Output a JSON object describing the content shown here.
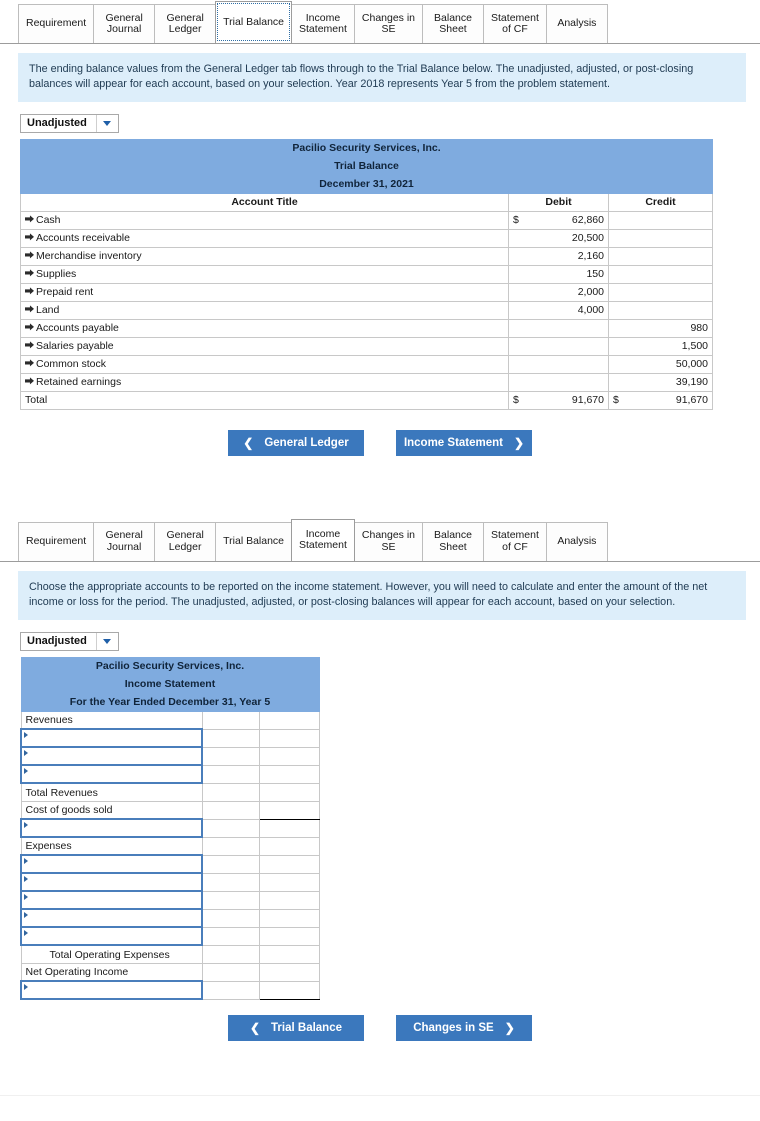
{
  "theme": {
    "accent_blue": "#3b78bd",
    "header_blue": "#7fabdf",
    "info_blue": "#ddeefa"
  },
  "panel1": {
    "tabs": [
      {
        "label": "Requirement",
        "active": false
      },
      {
        "label": "General\nJournal",
        "active": false
      },
      {
        "label": "General\nLedger",
        "active": false
      },
      {
        "label": "Trial Balance",
        "active": true
      },
      {
        "label": "Income\nStatement",
        "active": false
      },
      {
        "label": "Changes in\nSE",
        "active": false
      },
      {
        "label": "Balance\nSheet",
        "active": false
      },
      {
        "label": "Statement\nof CF",
        "active": false
      },
      {
        "label": "Analysis",
        "active": false
      }
    ],
    "instructions": "The ending balance values from the General Ledger tab flows through to the Trial Balance below. The unadjusted, adjusted, or post-closing balances will appear for each account, based on your selection. Year 2018 represents Year 5 from the problem statement.",
    "dropdown_value": "Unadjusted",
    "title_lines": [
      "Pacilio Security Services, Inc.",
      "Trial Balance",
      "December 31, 2021"
    ],
    "columns": [
      "Account Title",
      "Debit",
      "Credit"
    ],
    "rows": [
      {
        "account": "Cash",
        "debit": "62,860",
        "credit": "",
        "dollar_debit": true
      },
      {
        "account": "Accounts receivable",
        "debit": "20,500",
        "credit": ""
      },
      {
        "account": "Merchandise inventory",
        "debit": "2,160",
        "credit": ""
      },
      {
        "account": "Supplies",
        "debit": "150",
        "credit": ""
      },
      {
        "account": "Prepaid rent",
        "debit": "2,000",
        "credit": ""
      },
      {
        "account": "Land",
        "debit": "4,000",
        "credit": ""
      },
      {
        "account": "Accounts payable",
        "debit": "",
        "credit": "980"
      },
      {
        "account": "Salaries payable",
        "debit": "",
        "credit": "1,500"
      },
      {
        "account": "Common stock",
        "debit": "",
        "credit": "50,000"
      },
      {
        "account": "Retained earnings",
        "debit": "",
        "credit": "39,190"
      }
    ],
    "total": {
      "label": "Total",
      "debit": "91,670",
      "credit": "91,670"
    },
    "prev_button": "General Ledger",
    "next_button": "Income Statement"
  },
  "panel2": {
    "tabs": [
      {
        "label": "Requirement",
        "active": false
      },
      {
        "label": "General\nJournal",
        "active": false
      },
      {
        "label": "General\nLedger",
        "active": false
      },
      {
        "label": "Trial Balance",
        "active": false
      },
      {
        "label": "Income\nStatement",
        "active": true
      },
      {
        "label": "Changes in\nSE",
        "active": false
      },
      {
        "label": "Balance\nSheet",
        "active": false
      },
      {
        "label": "Statement\nof CF",
        "active": false
      },
      {
        "label": "Analysis",
        "active": false
      }
    ],
    "instructions": "Choose the appropriate accounts to be reported on the income statement. However, you will need to calculate and enter the amount of the net income or loss for the period. The unadjusted, adjusted, or post-closing balances will appear for each account, based on your selection.",
    "dropdown_value": "Unadjusted",
    "title_lines": [
      "Pacilio Security Services, Inc.",
      "Income Statement",
      "For the Year Ended December 31, Year 5"
    ],
    "rows": [
      {
        "label": "Revenues",
        "type": "label"
      },
      {
        "label": "",
        "type": "input"
      },
      {
        "label": "",
        "type": "input"
      },
      {
        "label": "",
        "type": "input"
      },
      {
        "label": "Total Revenues",
        "type": "label"
      },
      {
        "label": "Cost of goods sold",
        "type": "label"
      },
      {
        "label": "",
        "type": "input"
      },
      {
        "label": "Expenses",
        "type": "label"
      },
      {
        "label": "",
        "type": "input"
      },
      {
        "label": "",
        "type": "input"
      },
      {
        "label": "",
        "type": "input"
      },
      {
        "label": "",
        "type": "input"
      },
      {
        "label": "",
        "type": "input"
      },
      {
        "label": "Total Operating Expenses",
        "type": "label-indent"
      },
      {
        "label": "Net Operating Income",
        "type": "label"
      },
      {
        "label": "",
        "type": "input"
      }
    ],
    "prev_button": "Trial Balance",
    "next_button": "Changes in SE"
  },
  "icons": {
    "row_marker": "expand-row-icon",
    "caret": "chevron-down-icon",
    "prev": "chevron-left-icon",
    "next": "chevron-right-icon"
  }
}
